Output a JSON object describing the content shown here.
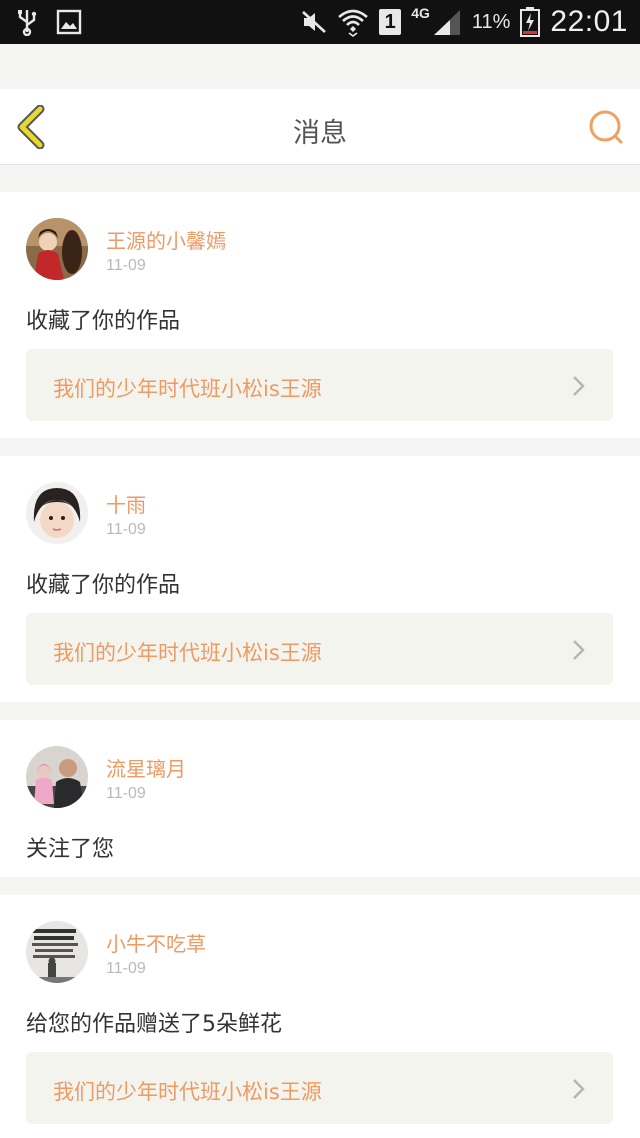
{
  "status_bar": {
    "time": "22:01",
    "battery": "11%",
    "network": "4G",
    "sim": "1",
    "icons": [
      "usb-icon",
      "gallery-icon",
      "mute-icon",
      "wifi-icon",
      "signal-icon",
      "battery-charging-icon"
    ]
  },
  "header": {
    "title": "消息",
    "back_icon": "chevron-left-icon",
    "search_icon": "search-icon",
    "accent": "#f0a060",
    "back_color": "#e8d830"
  },
  "messages": [
    {
      "user": "王源的小馨嫣",
      "date": "11-09",
      "action": "收藏了你的作品",
      "work": "我们的少年时代班小松is王源"
    },
    {
      "user": "十雨",
      "date": "11-09",
      "action": "收藏了你的作品",
      "work": "我们的少年时代班小松is王源"
    },
    {
      "user": "流星璃月",
      "date": "11-09",
      "action": "关注了您"
    },
    {
      "user": "小牛不吃草",
      "date": "11-09",
      "action": "给您的作品赠送了5朵鲜花",
      "work": "我们的少年时代班小松is王源"
    }
  ],
  "colors": {
    "username": "#ee9a63",
    "date": "#b9b9b9",
    "link_bg": "#f4f4ef",
    "page_bg": "#f5f5f3"
  }
}
